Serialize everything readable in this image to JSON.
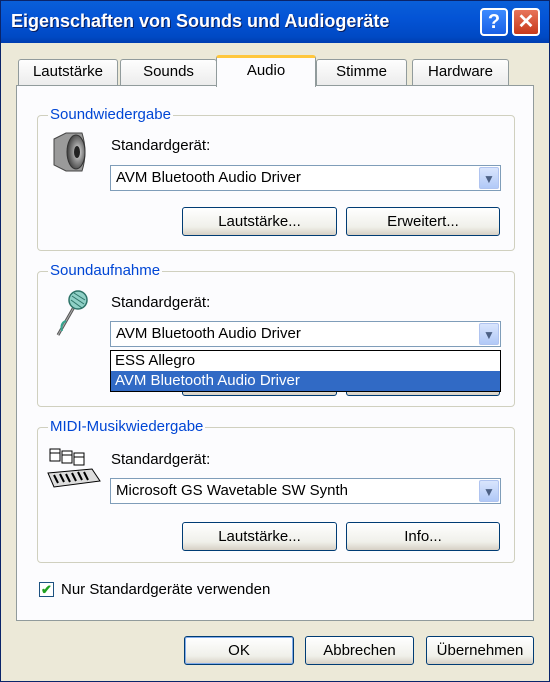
{
  "window": {
    "title": "Eigenschaften von Sounds und Audiogeräte",
    "help_label": "?",
    "close_label": "✕"
  },
  "tabs": [
    {
      "label": "Lautstärke",
      "active": false
    },
    {
      "label": "Sounds",
      "active": false
    },
    {
      "label": "Audio",
      "active": true
    },
    {
      "label": "Stimme",
      "active": false
    },
    {
      "label": "Hardware",
      "active": false
    }
  ],
  "playback": {
    "legend": "Soundwiedergabe",
    "device_label": "Standardgerät:",
    "device_value": "AVM Bluetooth Audio Driver",
    "volume_button": "Lautstärke...",
    "advanced_button": "Erweitert...",
    "icon": "speaker-icon"
  },
  "recording": {
    "legend": "Soundaufnahme",
    "device_label": "Standardgerät:",
    "device_value": "AVM Bluetooth Audio Driver",
    "dropdown_options": [
      "ESS Allegro",
      "AVM Bluetooth Audio Driver"
    ],
    "selected_option": "AVM Bluetooth Audio Driver",
    "icon": "microphone-icon"
  },
  "midi": {
    "legend": "MIDI-Musikwiedergabe",
    "device_label": "Standardgerät:",
    "device_value": "Microsoft GS Wavetable SW Synth",
    "volume_button": "Lautstärke...",
    "info_button": "Info...",
    "icon": "midi-keyboard-icon"
  },
  "options": {
    "only_default_label": "Nur Standardgeräte verwenden",
    "only_default_checked": true
  },
  "footer": {
    "ok": "OK",
    "cancel": "Abbrechen",
    "apply": "Übernehmen"
  },
  "colors": {
    "accent": "#0046d5",
    "selection": "#316ac5",
    "titlebar": "#0454d6"
  }
}
